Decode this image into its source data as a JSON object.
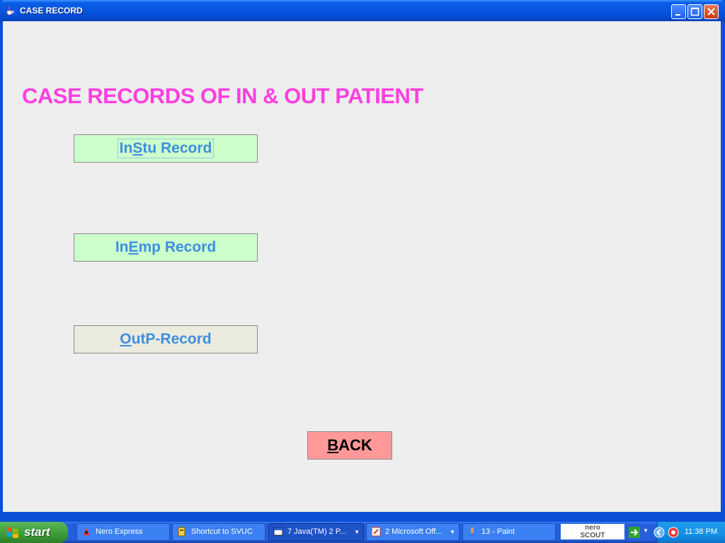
{
  "window": {
    "title": "CASE RECORD"
  },
  "page": {
    "heading": "CASE RECORDS OF IN & OUT PATIENT"
  },
  "buttons": {
    "instu": {
      "pre": "In",
      "mnemonic": "S",
      "post": "tu Record"
    },
    "inemp": {
      "pre": "In",
      "mnemonic": "E",
      "post": "mp Record"
    },
    "outp": {
      "pre": "",
      "mnemonic": "O",
      "post": "utP-Record"
    },
    "back": {
      "pre": "",
      "mnemonic": "B",
      "post": "ACK"
    }
  },
  "taskbar": {
    "start_label": "start",
    "tasks": [
      {
        "label": "Nero Express"
      },
      {
        "label": "Shortcut to SVUC"
      },
      {
        "label": "7 Java(TM) 2 P..."
      },
      {
        "label": "2 Microsoft Off..."
      },
      {
        "label": "13 - Paint"
      }
    ],
    "nero_scout": {
      "line1": "nero",
      "line2": "SCOUT"
    },
    "clock": "11:38 PM"
  },
  "colors": {
    "heading": "#ff3fe0",
    "button_text": "#3d8fe0",
    "green_button": "#ccffcc",
    "back_button": "#ff9999"
  }
}
